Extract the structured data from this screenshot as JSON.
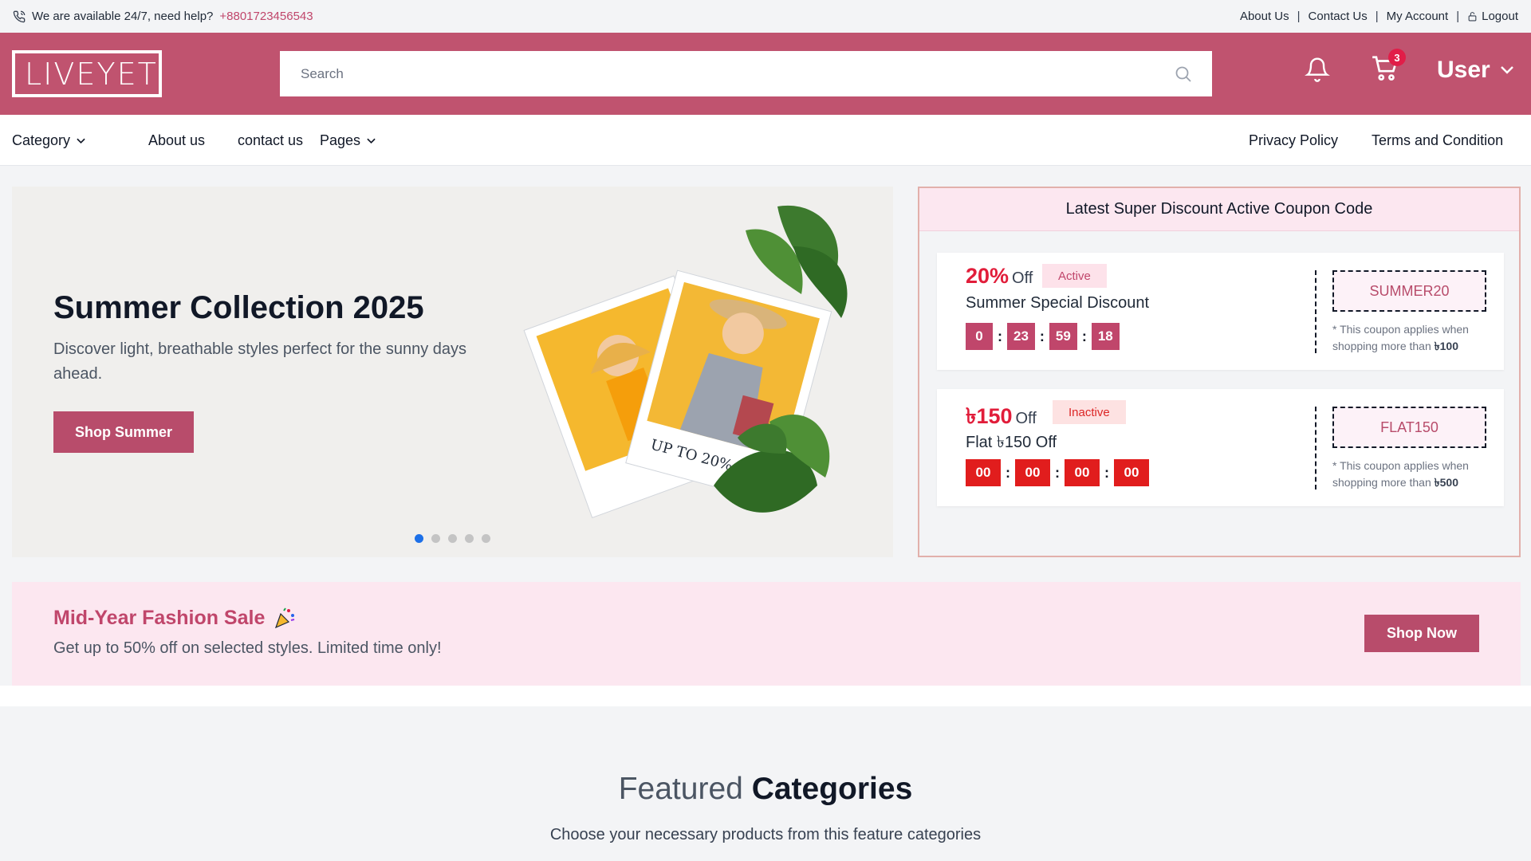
{
  "topbar": {
    "help_text": "We are available 24/7, need help?",
    "phone": "+8801723456543",
    "links": [
      "About Us",
      "Contact Us",
      "My Account"
    ],
    "logout": "Logout"
  },
  "header": {
    "logo": "LIVEYET",
    "search_placeholder": "Search",
    "cart_count": "3",
    "user_label": "User",
    "brand_color": "#c0536f"
  },
  "nav": {
    "category": "Category",
    "about": "About us",
    "contact": "contact us",
    "pages": "Pages",
    "privacy": "Privacy Policy",
    "terms": "Terms and Condition"
  },
  "hero": {
    "title": "Summer Collection 2025",
    "description": "Discover light, breathable styles perfect for the sunny days ahead.",
    "button": "Shop Summer",
    "promo_tag": "UP TO 20% OFF",
    "slide_count": 5,
    "active_slide": 1
  },
  "coupons": {
    "title": "Latest Super Discount Active Coupon Code",
    "items": [
      {
        "amount": "20%",
        "off": "Off",
        "status": "Active",
        "name": "Summer Special Discount",
        "timer": [
          "0",
          "23",
          "59",
          "18"
        ],
        "code": "SUMMER20",
        "note": "* This coupon applies when shopping more than",
        "min_amount": "৳100",
        "timer_color": "#c0466b"
      },
      {
        "amount": "৳150",
        "off": "Off",
        "status": "Inactive",
        "name": "Flat ৳150 Off",
        "timer": [
          "00",
          "00",
          "00",
          "00"
        ],
        "code": "FLAT150",
        "note": "* This coupon applies when shopping more than",
        "min_amount": "৳500",
        "timer_color": "#e11d1d"
      }
    ]
  },
  "sale": {
    "title": "Mid-Year Fashion Sale",
    "subtitle": "Get up to 50% off on selected styles. Limited time only!",
    "button": "Shop Now"
  },
  "featured": {
    "title_light": "Featured",
    "title_bold": "Categories",
    "subtitle": "Choose your necessary products from this feature categories"
  }
}
